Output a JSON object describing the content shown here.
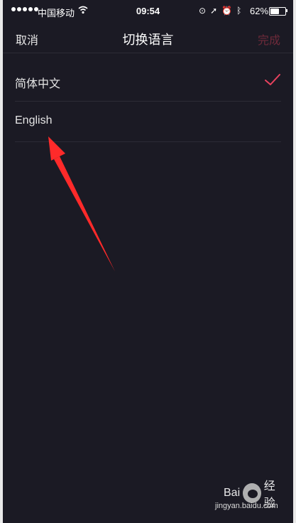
{
  "status_bar": {
    "carrier": "中国移动",
    "time": "09:54",
    "battery_percent": "62%",
    "battery_level": 0.62,
    "icons": [
      "orientation-lock-icon",
      "location-arrow-icon",
      "alarm-icon",
      "bluetooth-icon"
    ]
  },
  "nav": {
    "cancel": "取消",
    "title": "切换语言",
    "done": "完成",
    "done_color": "#6e2a3a"
  },
  "languages": [
    {
      "label": "简体中文",
      "selected": true
    },
    {
      "label": "English",
      "selected": false
    }
  ],
  "accent_color": "#e8425e",
  "annotation": {
    "arrow_color": "#ff2a2a"
  },
  "watermark": {
    "brand_left": "Bai",
    "brand_right": "经验",
    "url": "jingyan.baidu.com"
  }
}
